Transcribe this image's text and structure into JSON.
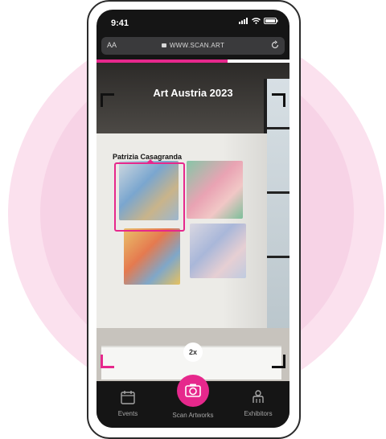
{
  "status": {
    "time": "9:41"
  },
  "browser": {
    "text_size_label": "AA",
    "url": "WWW.SCAN.ART"
  },
  "page": {
    "title": "Art Austria 2023",
    "scan_progress": 0.68
  },
  "detection": {
    "artist_name": "Patrizia Casagranda"
  },
  "camera": {
    "zoom_label": "2x"
  },
  "tabs": [
    {
      "label": "Events",
      "icon": "calendar-icon"
    },
    {
      "label": "Scan Artworks",
      "icon": "camera-icon"
    },
    {
      "label": "Exhibitors",
      "icon": "exhibitor-icon"
    }
  ],
  "colors": {
    "accent": "#e6288c",
    "halo": "#fbe1ee",
    "screen_bg": "#151515"
  }
}
